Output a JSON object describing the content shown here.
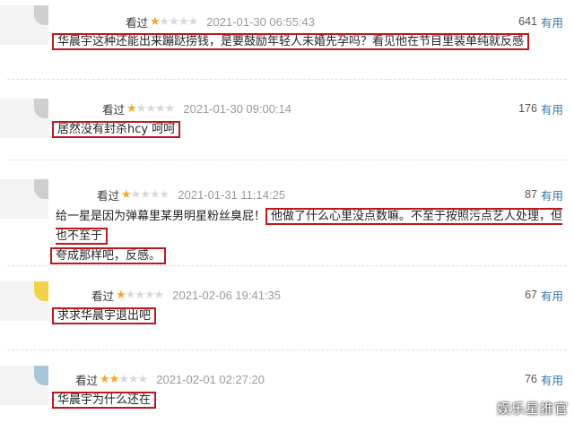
{
  "reviews": [
    {
      "status": "看过",
      "rating": 1,
      "time": "2021-01-30 06:55:43",
      "votes": "641",
      "useful": "有用",
      "comment": "华晨宇这种还能出来蹦跶捞钱，是要鼓励年轻人未婚先孕吗？看见他在节目里装单纯就反感"
    },
    {
      "status": "看过",
      "rating": 1,
      "time": "2021-01-30 09:00:14",
      "votes": "176",
      "useful": "有用",
      "comment": "居然没有封杀hcy 呵呵"
    },
    {
      "status": "看过",
      "rating": 1,
      "time": "2021-01-31 11:14:25",
      "votes": "87",
      "useful": "有用",
      "comment_pre": "给一星是因为弹幕里某男明星粉丝臭屁！",
      "comment_box1": "他做了什么心里没点数嘛。不至于按照污点艺人处理，但也不至于",
      "comment_box2": "夸成那样吧，反感。"
    },
    {
      "status": "看过",
      "rating": 1,
      "time": "2021-02-06 19:41:35",
      "votes": "67",
      "useful": "有用",
      "comment": "求求华晨宇退出吧"
    },
    {
      "status": "看过",
      "rating": 2,
      "time": "2021-02-01 02:27:20",
      "votes": "76",
      "useful": "有用",
      "comment": "华晨宇为什么还在"
    }
  ],
  "watermark": "娱乐星推官",
  "colors": {
    "star_on": "#f5a623",
    "star_off": "#d8d8d8",
    "link": "#3377aa",
    "highlight_box": "#c0171c"
  }
}
